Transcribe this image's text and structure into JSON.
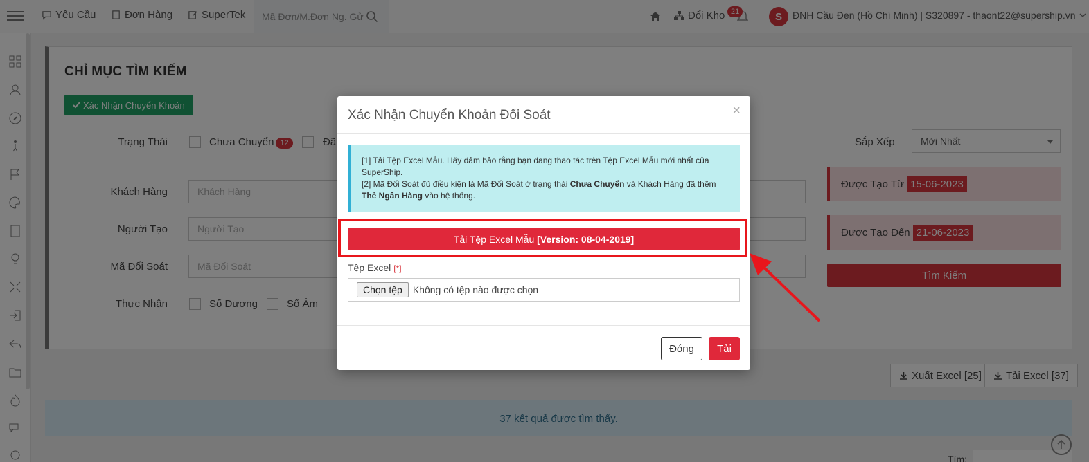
{
  "topbar": {
    "nav": [
      "Yêu Cầu",
      "Đơn Hàng",
      "SuperTek"
    ],
    "search_placeholder": "Mã Đơn/M.Đơn Ng. Gử",
    "doi_kho": "Đổi Kho",
    "notif_count": "21",
    "avatar_letter": "S",
    "user_info": "ĐNH Cầu Đen (Hồ Chí Minh) | S320897 - thaont22@supership.vn"
  },
  "panel": {
    "title": "CHỈ MỤC TÌM KIẾM",
    "confirm_button": "Xác Nhận Chuyển Khoản",
    "status_label": "Trạng Thái",
    "status_option_1": "Chưa Chuyển",
    "status_option_1_count": "12",
    "status_option_2": "Đã",
    "customer_label": "Khách Hàng",
    "customer_placeholder": "Khách Hàng",
    "creator_label": "Người Tạo",
    "creator_placeholder": "Người Tạo",
    "code_label": "Mã Đối Soát",
    "code_placeholder": "Mã Đối Soát",
    "received_label": "Thực Nhận",
    "received_pos": "Số Dương",
    "received_neg": "Số Âm",
    "sort_label": "Sắp Xếp",
    "sort_value": "Mới Nhất",
    "created_from_label": "Được Tạo Từ",
    "created_from_value": "15-06-2023",
    "created_to_label": "Được Tạo Đến",
    "created_to_value": "21-06-2023",
    "search_button": "Tìm Kiếm"
  },
  "export": {
    "export_excel": "Xuất Excel [25]",
    "download_excel": "Tải Excel [37]"
  },
  "results": "37 kết quả được tìm thấy.",
  "find_label": "Tìm:",
  "modal": {
    "title": "Xác Nhận Chuyển Khoản Đối Soát",
    "close_x": "×",
    "info_line1": "[1] Tải Tệp Excel Mẫu. Hãy đảm bảo rằng bạn đang thao tác trên Tệp Excel Mẫu mới nhất của SuperShip.",
    "info_line2_a": "[2] Mã Đối Soát đủ điều kiện là Mã Đối Soát ở trạng thái ",
    "info_line2_b": "Chưa Chuyển",
    "info_line2_c": " và Khách Hàng đã thêm ",
    "info_line2_d": "Thẻ Ngân Hàng",
    "info_line2_e": " vào hệ thống.",
    "template_button_a": "Tải Tệp Excel Mẫu ",
    "template_button_b": "[Version: 08-04-2019]",
    "file_label": "Tệp Excel",
    "file_required": "[*]",
    "file_button": "Chọn tệp",
    "file_none": "Không có tệp nào được chọn",
    "close_button": "Đóng",
    "upload_button": "Tải"
  },
  "colors": {
    "accent_red": "#e0283a",
    "highlight_red": "#e8161c",
    "green": "#21a366"
  }
}
